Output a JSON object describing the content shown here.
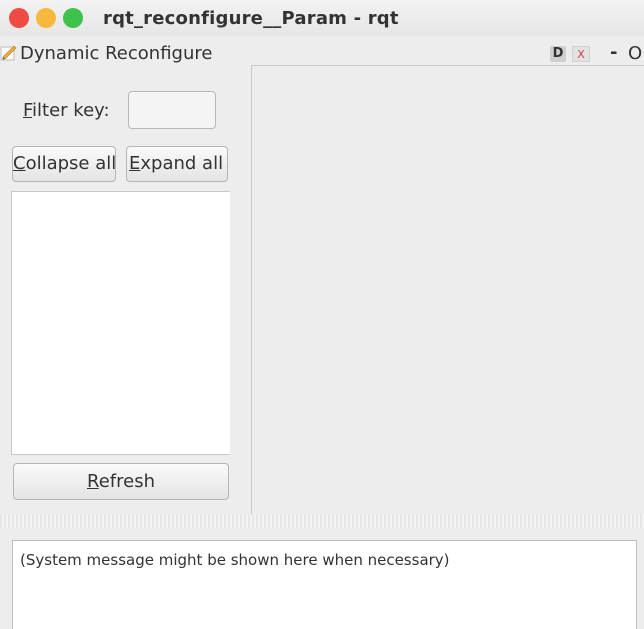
{
  "window": {
    "title": "rqt_reconfigure__Param - rqt"
  },
  "dock": {
    "title": "Dynamic Reconfigure",
    "d_label": "D",
    "close_label": "X",
    "dash_label": "-",
    "o_label": "O"
  },
  "filter": {
    "label_first": "F",
    "label_rest": "ilter key:",
    "value": ""
  },
  "buttons": {
    "collapse_first": "C",
    "collapse_rest": "ollapse all",
    "expand_first": "E",
    "expand_rest": "xpand all",
    "refresh_first": "R",
    "refresh_rest": "efresh"
  },
  "message": {
    "text": "(System message might be shown here when necessary)"
  },
  "icons": {
    "dock_icon": "edit-pencil-icon",
    "close_button": "close-icon",
    "minimize_button": "minimize-icon",
    "maximize_button": "maximize-icon"
  },
  "colors": {
    "close": "#ee4b45",
    "minimize": "#f6b93b",
    "maximize": "#3ec24c",
    "background": "#ededed"
  }
}
